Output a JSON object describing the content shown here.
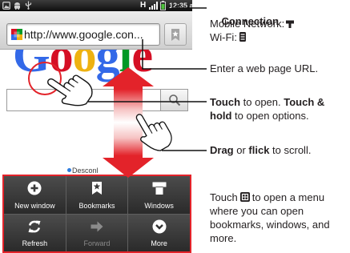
{
  "status_bar": {
    "network_type": "H",
    "time": "12:35 am"
  },
  "browser": {
    "url": "http://www.google.con...",
    "logo_letters": [
      "G",
      "o",
      "o",
      "g",
      "l",
      "e"
    ],
    "logo_colors": [
      "#3369e8",
      "#d50f25",
      "#eeb211",
      "#3369e8",
      "#009925",
      "#d50f25"
    ],
    "link_text": "Desconl"
  },
  "icons": {
    "status_left": [
      "notification-icon",
      "android-icon",
      "usb-icon"
    ],
    "status_right": [
      "signal-icon",
      "battery-icon"
    ],
    "address_bar": [
      "google-favicon-icon",
      "bookmark-icon"
    ],
    "search_button": "search-icon",
    "gestures": [
      "double-arrow-icon",
      "touch-hand-icon",
      "drag-hand-icon"
    ]
  },
  "menu": {
    "items": [
      {
        "label": "New window",
        "icon": "plus-circle-icon",
        "enabled": true
      },
      {
        "label": "Bookmarks",
        "icon": "bookmark-star-icon",
        "enabled": true
      },
      {
        "label": "Windows",
        "icon": "windows-icon",
        "enabled": true
      },
      {
        "label": "Refresh",
        "icon": "refresh-icon",
        "enabled": true
      },
      {
        "label": "Forward",
        "icon": "forward-arrow-icon",
        "enabled": false
      },
      {
        "label": "More",
        "icon": "more-chevron-icon",
        "enabled": true
      }
    ]
  },
  "callouts": {
    "connection": {
      "title": "Connection",
      "mobile_label": "Mobile Network:",
      "mobile_icon": "mobile-network-icon",
      "wifi_label": "Wi-Fi:",
      "wifi_icon": "wifi-icon"
    },
    "url": {
      "text": "Enter a web page URL."
    },
    "touch": {
      "line1": [
        {
          "text": "Touch",
          "bold": true
        },
        {
          "text": " to open. ",
          "bold": false
        },
        {
          "text": "Touch &",
          "bold": true
        }
      ],
      "line2": [
        {
          "text": "hold",
          "bold": true
        },
        {
          "text": " to open options.",
          "bold": false
        }
      ]
    },
    "drag": {
      "parts": [
        {
          "text": "Drag",
          "bold": true
        },
        {
          "text": " or ",
          "bold": false
        },
        {
          "text": "flick",
          "bold": true
        },
        {
          "text": " to scroll.",
          "bold": false
        }
      ]
    },
    "menu": {
      "lead": "Touch",
      "key_icon": "menu-key-icon",
      "rest": "to open a menu",
      "line2": "where you can open",
      "line3": "bookmarks, windows, and",
      "line4": "more."
    }
  },
  "colors": {
    "highlight_red": "#e3232a",
    "callout_text": "#231f20",
    "menu_background": "#3a3a3a",
    "disabled_label": "#8a8a8a",
    "link_dot": "#2d7de0"
  }
}
